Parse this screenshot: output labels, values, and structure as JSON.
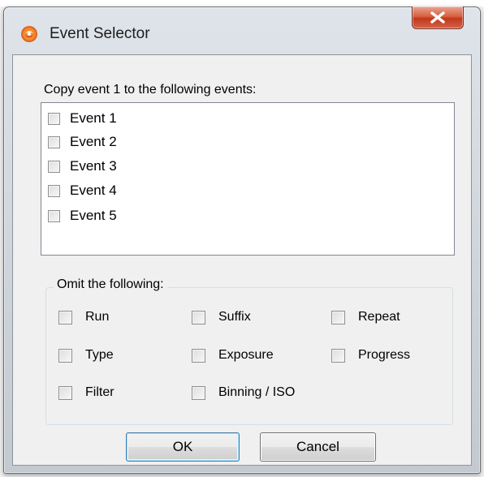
{
  "window": {
    "title": "Event Selector",
    "close_symbol": "x"
  },
  "prompt": "Copy event 1 to the following events:",
  "events": [
    {
      "label": "Event 1",
      "checked": false
    },
    {
      "label": "Event 2",
      "checked": false
    },
    {
      "label": "Event 3",
      "checked": false
    },
    {
      "label": "Event 4",
      "checked": false
    },
    {
      "label": "Event 5",
      "checked": false
    }
  ],
  "omit": {
    "title": "Omit the following:",
    "options": [
      {
        "label": "Run",
        "checked": false
      },
      {
        "label": "Suffix",
        "checked": false
      },
      {
        "label": "Repeat",
        "checked": false
      },
      {
        "label": "Type",
        "checked": false
      },
      {
        "label": "Exposure",
        "checked": false
      },
      {
        "label": "Progress",
        "checked": false
      },
      {
        "label": "Filter",
        "checked": false
      },
      {
        "label": "Binning / ISO",
        "checked": false
      }
    ]
  },
  "buttons": {
    "ok": "OK",
    "cancel": "Cancel"
  },
  "icons": {
    "app": "app-logo-icon",
    "close": "close-x-icon"
  },
  "colors": {
    "close_button": "#c9442a",
    "default_button_border": "#3c7fb1"
  }
}
